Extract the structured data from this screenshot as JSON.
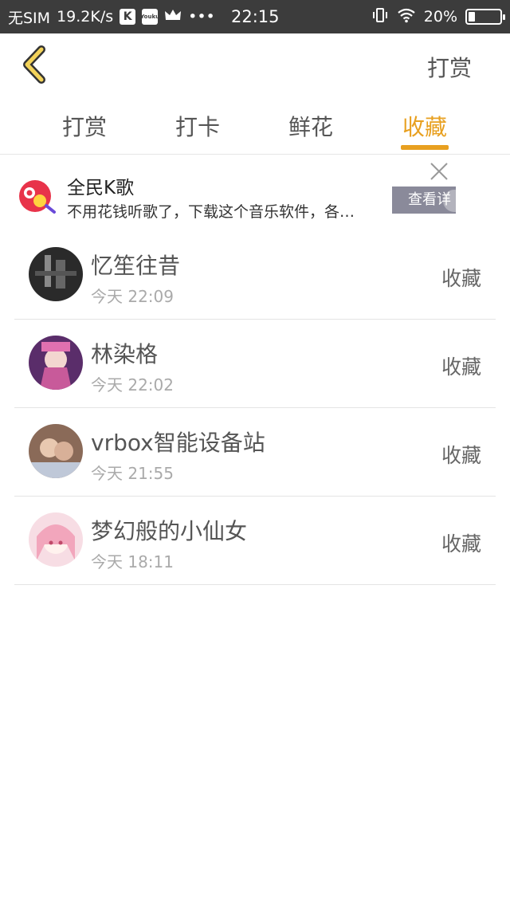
{
  "status_bar": {
    "carrier": "无SIM",
    "speed": "19.2K/s",
    "app_badge_k": "K",
    "app_badge_youku": "Youku",
    "dots": "•••",
    "time": "22:15",
    "battery_text": "20%",
    "battery_level": 0.2
  },
  "header": {
    "action_label": "打赏"
  },
  "tabs": [
    {
      "label": "打赏",
      "active": false
    },
    {
      "label": "打卡",
      "active": false
    },
    {
      "label": "鲜花",
      "active": false
    },
    {
      "label": "收藏",
      "active": true
    }
  ],
  "ad": {
    "title": "全民K歌",
    "description": "不用花钱听歌了，下载这个音乐软件，各…",
    "button_label": "查看详"
  },
  "items": [
    {
      "name": "忆笙往昔",
      "time": "今天 22:09",
      "action": "收藏",
      "avatar_color": "#2a2a2a"
    },
    {
      "name": "林染格",
      "time": "今天 22:02",
      "action": "收藏",
      "avatar_color": "#6a3a7a"
    },
    {
      "name": "vrbox智能设备站",
      "time": "今天 21:55",
      "action": "收藏",
      "avatar_color": "#7a5a4a"
    },
    {
      "name": "梦幻般的小仙女",
      "time": "今天 18:11",
      "action": "收藏",
      "avatar_color": "#f2b6c6"
    }
  ],
  "colors": {
    "accent": "#e8a020",
    "status_bar": "#3c3c3c",
    "ad_logo": "#e8334a"
  }
}
